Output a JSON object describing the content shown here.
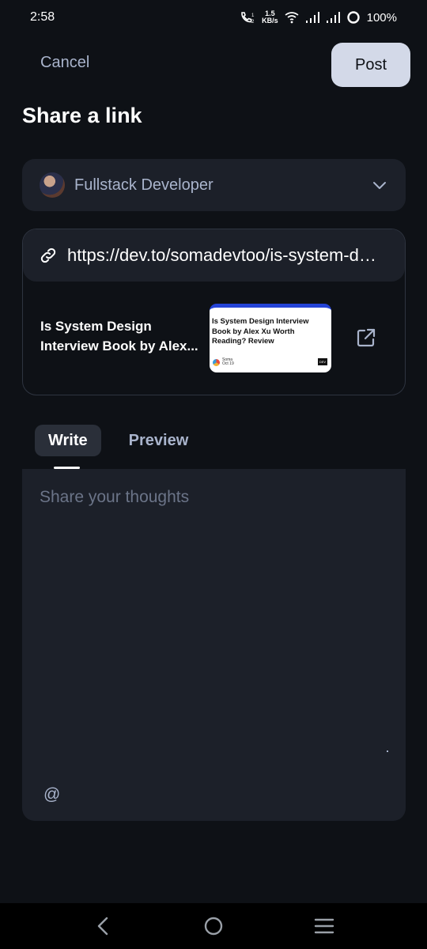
{
  "status_bar": {
    "time": "2:58",
    "net_speed_value": "1.5",
    "net_speed_unit": "KB/s",
    "battery": "100%"
  },
  "header": {
    "cancel_label": "Cancel",
    "post_label": "Post",
    "title": "Share a link"
  },
  "squad": {
    "name": "Fullstack Developer"
  },
  "link": {
    "url": "https://dev.to/somadevtoo/is-system-design-interview-book-by-alex-xu-worth-reading-review",
    "preview_title": "Is System Design Interview Book by Alex...",
    "thumbnail_title": "Is System Design Interview Book by Alex Xu Worth Reading? Review",
    "thumbnail_author": "Soma",
    "thumbnail_date": "Oct 19",
    "thumbnail_badge": "DEV"
  },
  "tabs": [
    {
      "label": "Write",
      "active": true
    },
    {
      "label": "Preview",
      "active": false
    }
  ],
  "editor": {
    "placeholder": "Share your thoughts",
    "mention_label": "@"
  },
  "icons": {
    "link": "link-icon",
    "chevron": "chevron-down-icon",
    "open_link": "external-link-icon",
    "nav_back": "back-icon",
    "nav_home": "home-icon",
    "nav_recents": "menu-icon"
  },
  "colors": {
    "background": "#0e1116",
    "surface": "#1c2029",
    "accent_button": "#d3d9e8",
    "muted_text": "#a9b4cc"
  }
}
